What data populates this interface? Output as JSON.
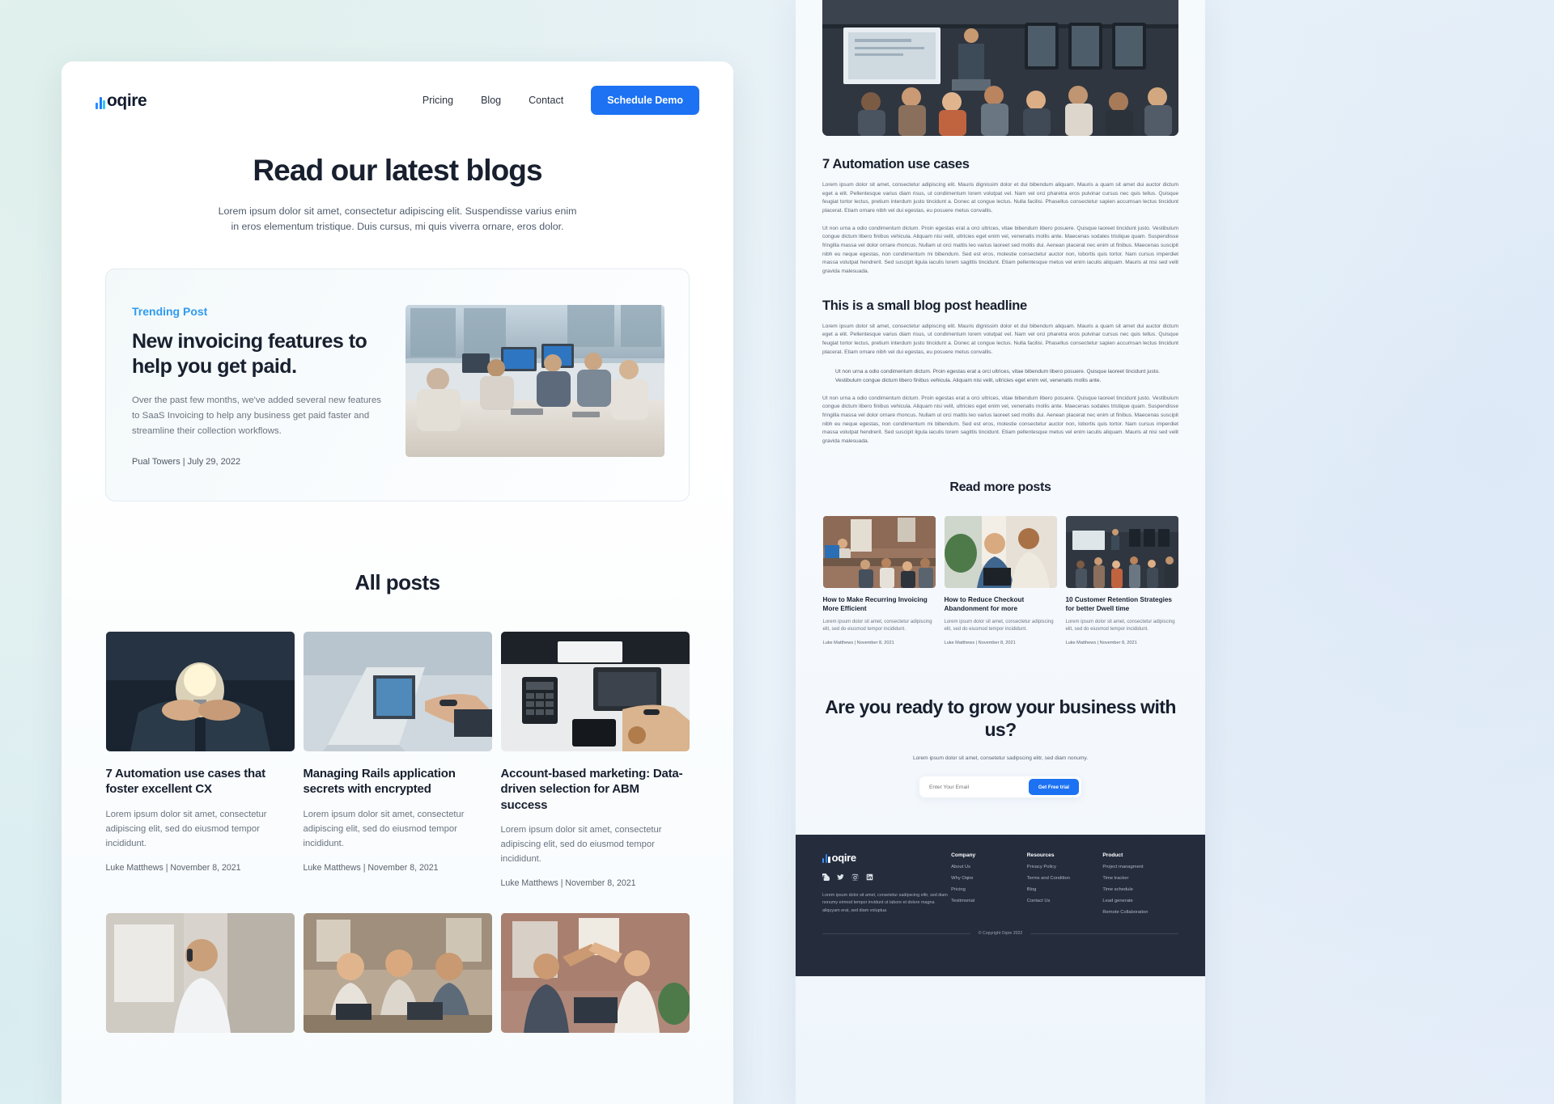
{
  "brand": {
    "name": "oqire",
    "logo_icon": "bar-chart-icon"
  },
  "left_page": {
    "nav": {
      "links": [
        {
          "label": "Pricing"
        },
        {
          "label": "Blog"
        },
        {
          "label": "Contact"
        }
      ],
      "cta_label": "Schedule Demo"
    },
    "hero": {
      "title": "Read our latest blogs",
      "subtitle": "Lorem ipsum dolor sit amet, consectetur adipiscing elit. Suspendisse varius enim in eros elementum tristique. Duis cursus, mi quis viverra ornare, eros dolor."
    },
    "trending": {
      "tag": "Trending Post",
      "title": "New invoicing features to help you get paid.",
      "description": "Over the past few months, we've added several new features to SaaS Invoicing to help any business get paid faster and streamline their collection workflows.",
      "meta": "Pual Towers |  July 29, 2022",
      "image_alt": "team-working-at-desks-photo"
    },
    "all_posts": {
      "title": "All posts",
      "posts": [
        {
          "title": "7 Automation use cases that foster excellent CX",
          "excerpt": "Lorem ipsum dolor sit amet, consectetur adipiscing elit, sed do eiusmod tempor incididunt.",
          "meta": "Luke Matthews |  November 8, 2021",
          "image_alt": "hands-holding-lightbulb-photo"
        },
        {
          "title": "Managing Rails application secrets with encrypted",
          "excerpt": "Lorem ipsum dolor sit amet, consectetur adipiscing elit, sed do eiusmod tempor incididunt.",
          "meta": "Luke Matthews |  November 8, 2021",
          "image_alt": "hand-pointing-at-laptop-photo"
        },
        {
          "title": "Account-based marketing: Data-driven selection for ABM success",
          "excerpt": "Lorem ipsum dolor sit amet, consectetur adipiscing elit, sed do eiusmod tempor incididunt.",
          "meta": "Luke Matthews |  November 8, 2021",
          "image_alt": "desk-with-keyboard-and-phone-photo"
        },
        {
          "image_alt": "man-on-phone-in-office-photo"
        },
        {
          "image_alt": "colleagues-smiling-with-laptops-photo"
        },
        {
          "image_alt": "coworkers-high-five-photo"
        }
      ]
    }
  },
  "right_page": {
    "hero_image_alt": "conference-presentation-photo",
    "article": {
      "heading": "7 Automation use cases",
      "paragraph_1": "Lorem ipsum dolor sit amet, consectetur adipiscing elit. Mauris dignissim dolor et dui bibendum aliquam. Mauris a quam sit amet dui auctor dictum eget a elit. Pellentesque varius diam risus, ut condimentum lorem volutpat vel. Nam vel orci pharetra eros pulvinar cursus nec quis tellus. Quisque feugiat tortor lectus, pretium interdum justo tincidunt a. Donec at congue lectus. Nulla facilisi. Phasellus consectetur sapien accumsan lectus tincidunt placerat. Etiam ornare nibh vel dui egestas, eu posuere metus convallis.",
      "paragraph_2": "Ut non urna a odio condimentum dictum. Proin egestas erat a orci ultrices, vitae bibendum libero posuere. Quisque laoreet tincidunt justo. Vestibulum congue dictum libero finibus vehicula. Aliquam nisi velit, ultricies eget enim vel, venenatis mollis ante. Maecenas sodales tristique quam. Suspendisse fringilla massa vel dolor ornare rhoncus. Nullam ut orci mattis leo varius laoreet sed mollis dui. Aenean placerat nec enim ut finibus. Maecenas suscipit nibh eu neque egestas, non condimentum mi bibendum. Sed est eros, molestie consectetur auctor non, lobortis quis tortor. Nam cursus imperdiet massa volutpat hendrerit. Sed suscipit ligula iaculis lorem sagittis tincidunt. Etiam pellentesque metus vel enim iaculis aliquam. Mauris at nisi sed velit gravida malesuada.",
      "sub_heading": "This is a small blog post headline",
      "paragraph_3": "Lorem ipsum dolor sit amet, consectetur adipiscing elit. Mauris dignissim dolor et dui bibendum aliquam. Mauris a quam sit amet dui auctor dictum eget a elit. Pellentesque varius diam risus, ut condimentum lorem volutpat vel. Nam vel orci pharetra eros pulvinar cursus nec quis tellus. Quisque feugiat tortor lectus, pretium interdum justo tincidunt a. Donec at congue lectus. Nulla facilisi. Phasellus consectetur sapien accumsan lectus tincidunt placerat. Etiam ornare nibh vel dui egestas, eu posuere metus convallis.",
      "quote": "Ut non urna a odio condimentum dictum. Proin egestas erat a orci ultrices, vitae bibendum libero posuere. Quisque laoreet tincidunt justo. Vestibulum congue dictum libero finibus vehicula. Aliquam nisi velit, ultricies eget enim vel, venenatis mollis ante.",
      "paragraph_4": "Ut non urna a odio condimentum dictum. Proin egestas erat a orci ultrices, vitae bibendum libero posuere. Quisque laoreet tincidunt justo. Vestibulum congue dictum libero finibus vehicula. Aliquam nisi velit, ultricies eget enim vel, venenatis mollis ante. Maecenas sodales tristique quam. Suspendisse fringilla massa vel dolor ornare rhoncus. Nullam ut orci mattis leo varius laoreet sed mollis dui. Aenean placerat nec enim ut finibus. Maecenas suscipit nibh eu neque egestas, non condimentum mi bibendum. Sed est eros, molestie consectetur auctor non, lobortis quis tortor. Nam cursus imperdiet massa volutpat hendrerit. Sed suscipit ligula iaculis lorem sagittis tincidunt. Etiam pellentesque metus vel enim iaculis aliquam. Mauris at nisi sed velit gravida malesuada."
    },
    "read_more": {
      "title": "Read more posts",
      "posts": [
        {
          "title": "How to Make Recurring Invoicing More Efficient",
          "excerpt": "Lorem ipsum dolor sit amet, consectetur adipiscing elit, sed do eiusmod tempor incididunt.",
          "meta": "Luke Matthews |  November 8, 2021",
          "image_alt": "office-meeting-brick-wall-photo"
        },
        {
          "title": "How to Reduce Checkout Abandonment for more",
          "excerpt": "Lorem ipsum dolor sit amet, consectetur adipiscing elit, sed do eiusmod tempor incididunt.",
          "meta": "Luke Matthews |  November 8, 2021",
          "image_alt": "two-men-talking-with-laptop-photo"
        },
        {
          "title": "10 Customer Retention Strategies for better Dwell time",
          "excerpt": "Lorem ipsum dolor sit amet, consectetur adipiscing elit, sed do eiusmod tempor incididunt.",
          "meta": "Luke Matthews |  November 8, 2021",
          "image_alt": "auditorium-presentation-photo"
        }
      ]
    },
    "cta": {
      "title": "Are you ready to grow your business with us?",
      "subtitle": "Lorem ipsum dolor sit amet, consetetur sadipscing elitr, sed diam nonumy.",
      "email_placeholder": "Enter Your Email",
      "button_label": "Get Free trial"
    },
    "footer": {
      "description": "Lorem ipsum dolor sit amet, consetetur sadipscing elitr, sed diam nonumy eirmod tempor invidunt ut labore et dolore magna aliquyam erat, sed diam voluptua",
      "socials": [
        {
          "name": "facebook-icon"
        },
        {
          "name": "twitter-icon"
        },
        {
          "name": "instagram-icon"
        },
        {
          "name": "linkedin-icon"
        }
      ],
      "columns": [
        {
          "heading": "Company",
          "links": [
            {
              "label": "About Us"
            },
            {
              "label": "Why Oqire"
            },
            {
              "label": "Pricing"
            },
            {
              "label": "Testimonial"
            }
          ]
        },
        {
          "heading": "Resources",
          "links": [
            {
              "label": "Privacy Policy"
            },
            {
              "label": "Terms and Condition"
            },
            {
              "label": "Blog"
            },
            {
              "label": "Contact Us"
            }
          ]
        },
        {
          "heading": "Product",
          "links": [
            {
              "label": "Project managment"
            },
            {
              "label": "Time tracker"
            },
            {
              "label": "Time schedule"
            },
            {
              "label": "Lead generate"
            },
            {
              "label": "Remote Collaboration"
            }
          ]
        }
      ],
      "copyright": "© Copyright Oqire 2022"
    }
  },
  "colors": {
    "accent_blue": "#1d72f3",
    "link_blue": "#2f9bf0",
    "heading": "#18202f",
    "footer_bg": "#252d3d"
  }
}
